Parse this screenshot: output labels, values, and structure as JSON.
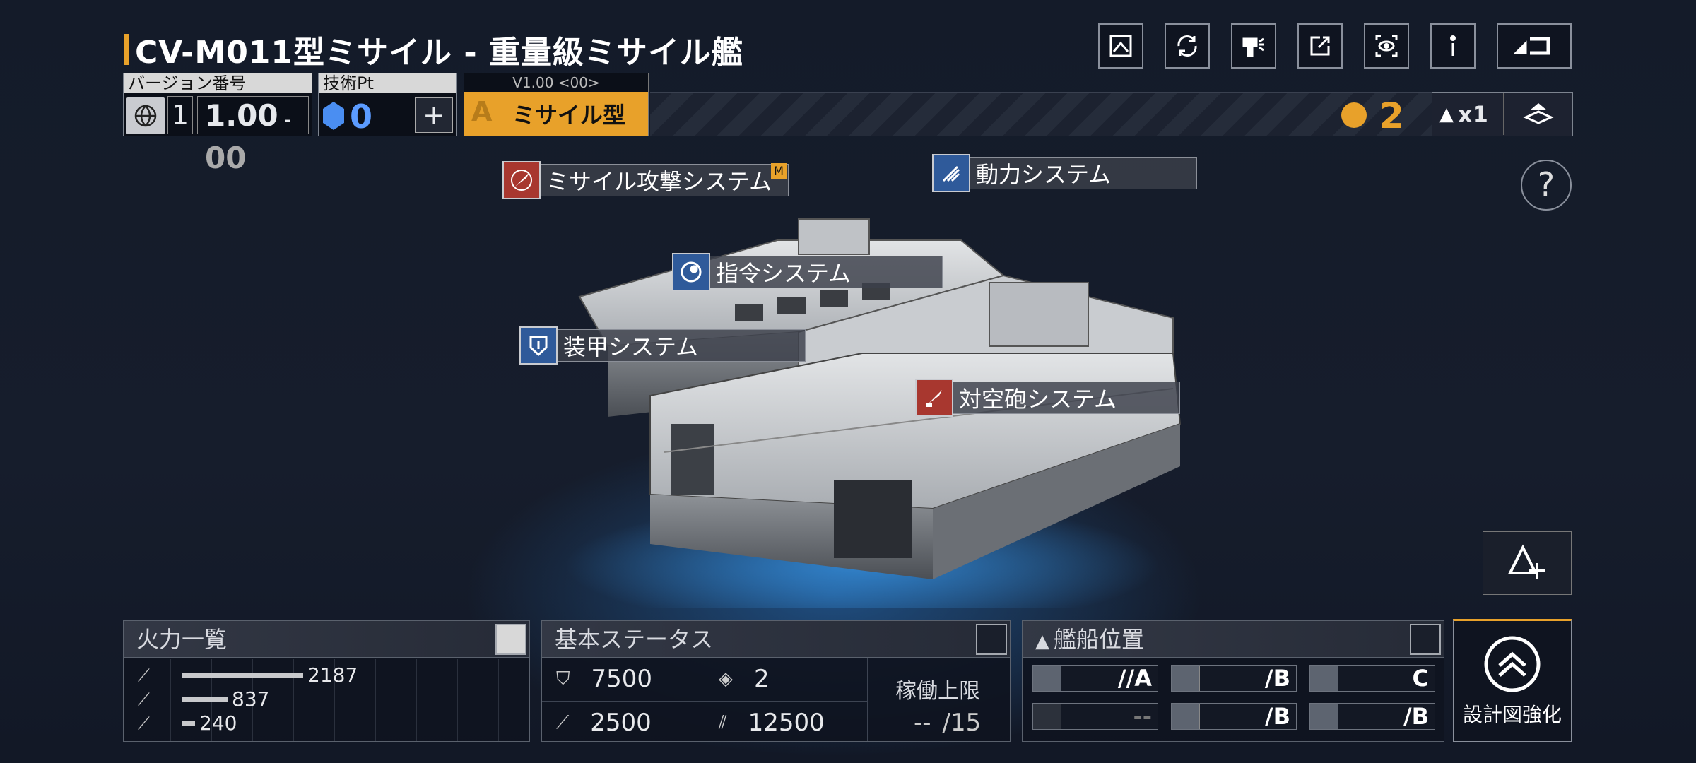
{
  "title": "CV-M011型ミサイル - 重量級ミサイル艦",
  "top_icons": [
    "blueprint-icon",
    "refresh-icon",
    "paint-icon",
    "share-icon",
    "view-icon",
    "info-icon",
    "return-icon"
  ],
  "version": {
    "label": "バージョン番号",
    "major": "1",
    "value": "1.00",
    "sub": "00"
  },
  "tech": {
    "label": "技術Pt",
    "value": "0",
    "add": "+"
  },
  "type_tag": {
    "version_text": "V1.00 <00>",
    "grade": "A",
    "label": "ミサイル型"
  },
  "rank": {
    "value": "2",
    "multiplier": "x1"
  },
  "help": "?",
  "systems": {
    "missile": "ミサイル攻撃システム",
    "missile_badge": "M",
    "power": "動力システム",
    "command": "指令システム",
    "armor": "装甲システム",
    "aa": "対空砲システム"
  },
  "firepower": {
    "title": "火力一覧",
    "values": [
      "2187",
      "837",
      "240"
    ],
    "fractions": [
      1.0,
      0.38,
      0.11
    ]
  },
  "status": {
    "title": "基本ステータス",
    "hp": "7500",
    "armor": "2",
    "speed": "2500",
    "cargo": "12500",
    "limit_label": "稼働上限",
    "limit_value": "--",
    "limit_max": "/15"
  },
  "position": {
    "title": "艦船位置",
    "slots": [
      [
        "//A",
        "/B",
        "C"
      ],
      [
        "--",
        "/B",
        "/B"
      ]
    ]
  },
  "upgrade": {
    "label": "設計図強化"
  },
  "colors": {
    "accent": "#e8a12a",
    "red": "#a8372f",
    "blue": "#2f5a9a"
  }
}
